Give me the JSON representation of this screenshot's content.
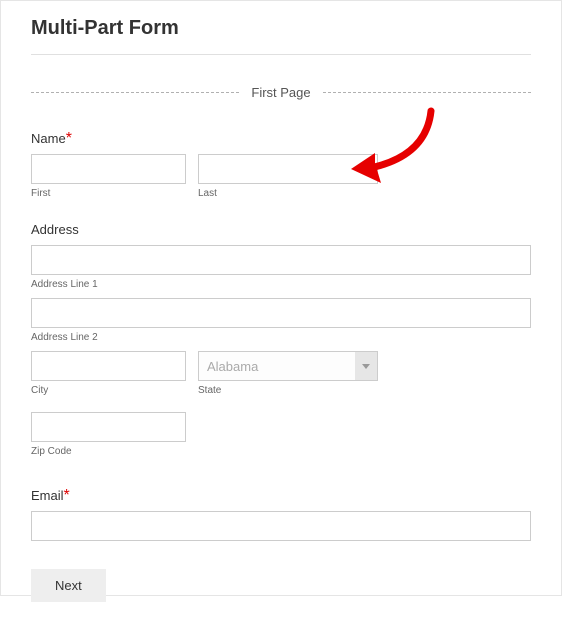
{
  "title": "Multi-Part Form",
  "page_divider_label": "First Page",
  "required_marker": "*",
  "name": {
    "label": "Name",
    "first_sub": "First",
    "last_sub": "Last"
  },
  "address": {
    "label": "Address",
    "line1_sub": "Address Line 1",
    "line2_sub": "Address Line 2",
    "city_sub": "City",
    "state_sub": "State",
    "state_selected": "Alabama",
    "zip_sub": "Zip Code"
  },
  "email": {
    "label": "Email"
  },
  "buttons": {
    "next": "Next"
  },
  "annotation": {
    "arrow_color": "#e60000"
  }
}
